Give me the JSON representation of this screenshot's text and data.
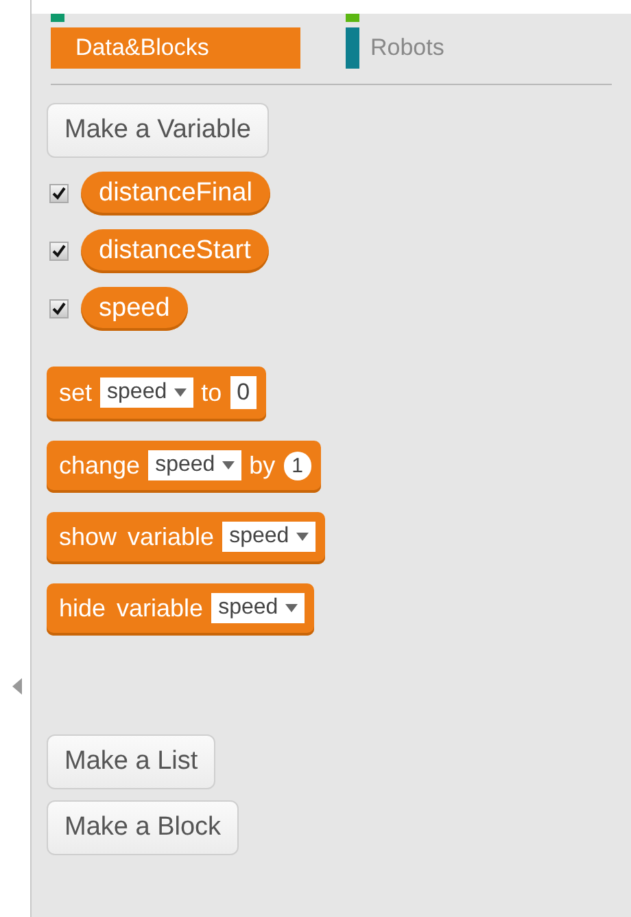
{
  "categories": [
    {
      "color": "#0f9a6c",
      "selected": false
    },
    {
      "color": "#5cb712",
      "selected": false
    },
    {
      "label": "Data&Blocks",
      "color": "#ee7d16",
      "selected": true
    },
    {
      "label": "Robots",
      "color": "#0e7f8f",
      "selected": false
    }
  ],
  "make_variable_button": "Make a Variable",
  "variables": [
    {
      "name": "distanceFinal",
      "checked": true
    },
    {
      "name": "distanceStart",
      "checked": true
    },
    {
      "name": "speed",
      "checked": true
    }
  ],
  "blocks": [
    {
      "parts": [
        {
          "kind": "text",
          "text": "set"
        },
        {
          "kind": "dropdown",
          "text": "speed"
        },
        {
          "kind": "text",
          "text": "to"
        },
        {
          "kind": "number",
          "text": "0"
        }
      ]
    },
    {
      "parts": [
        {
          "kind": "text",
          "text": "change"
        },
        {
          "kind": "dropdown",
          "text": "speed"
        },
        {
          "kind": "text",
          "text": "by"
        },
        {
          "kind": "round",
          "text": "1"
        }
      ]
    },
    {
      "parts": [
        {
          "kind": "text",
          "text": "show variable"
        },
        {
          "kind": "dropdown",
          "text": "speed"
        }
      ]
    },
    {
      "parts": [
        {
          "kind": "text",
          "text": "hide variable"
        },
        {
          "kind": "dropdown",
          "text": "speed"
        }
      ]
    }
  ],
  "make_list_button": "Make a List",
  "make_block_button": "Make a Block"
}
